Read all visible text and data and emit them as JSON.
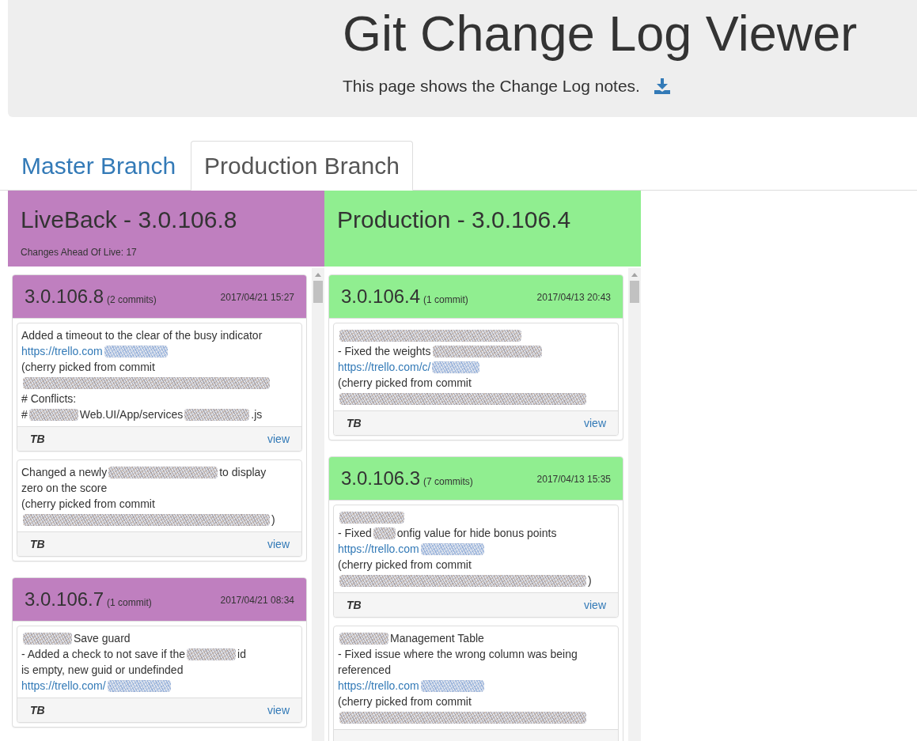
{
  "header": {
    "title": "Git Change Log Viewer",
    "subtitle": "This page shows the Change Log notes."
  },
  "tabs": [
    {
      "label": "Master Branch",
      "selected": false
    },
    {
      "label": "Production Branch",
      "selected": true
    }
  ],
  "columns": [
    {
      "title": "LiveBack - 3.0.106.8",
      "note": "Changes Ahead Of Live: 17",
      "color": "#bf7fbf",
      "releases": [
        {
          "version": "3.0.106.8",
          "commits_label": "(2 commits)",
          "date": "2017/04/21 15:27",
          "commits": [
            {
              "lines": [
                [
                  {
                    "kind": "text",
                    "text": "Added a timeout to the clear of the busy indicator"
                  }
                ],
                [
                  {
                    "kind": "link",
                    "text": "https://trello.com"
                  },
                  {
                    "kind": "linkblur_medium"
                  }
                ],
                [
                  {
                    "kind": "text",
                    "text": "(cherry picked from commit"
                  }
                ],
                [
                  {
                    "kind": "blur_full"
                  }
                ],
                [
                  {
                    "kind": "text",
                    "text": "# Conflicts:"
                  }
                ],
                [
                  {
                    "kind": "text",
                    "text": "#"
                  },
                  {
                    "kind": "blur_short"
                  },
                  {
                    "kind": "text",
                    "text": "Web.UI/App/services"
                  },
                  {
                    "kind": "blur_medium"
                  },
                  {
                    "kind": "text",
                    "text": ".js"
                  }
                ]
              ],
              "author": "TB",
              "action": "view"
            },
            {
              "lines": [
                [
                  {
                    "kind": "text",
                    "text": "Changed a newly"
                  },
                  {
                    "kind": "blur_long"
                  },
                  {
                    "kind": "text",
                    "text": "to display"
                  }
                ],
                [
                  {
                    "kind": "text",
                    "text": "zero on the score"
                  }
                ],
                [
                  {
                    "kind": "text",
                    "text": "(cherry picked from commit"
                  }
                ],
                [
                  {
                    "kind": "blur_full"
                  },
                  {
                    "kind": "text",
                    "text": ")"
                  }
                ]
              ],
              "author": "TB",
              "action": "view"
            }
          ]
        },
        {
          "version": "3.0.106.7",
          "commits_label": "(1 commit)",
          "date": "2017/04/21 08:34",
          "commits": [
            {
              "lines": [
                [
                  {
                    "kind": "blur_short"
                  },
                  {
                    "kind": "text",
                    "text": "Save guard"
                  }
                ],
                [
                  {
                    "kind": "text",
                    "text": "- Added a check to not save if the"
                  },
                  {
                    "kind": "blur_short"
                  },
                  {
                    "kind": "text",
                    "text": "id"
                  }
                ],
                [
                  {
                    "kind": "text",
                    "text": "is empty, new guid or undefinded"
                  }
                ],
                [
                  {
                    "kind": "link",
                    "text": "https://trello.com/"
                  },
                  {
                    "kind": "linkblur_medium"
                  }
                ]
              ],
              "author": "TB",
              "action": "view"
            }
          ]
        }
      ]
    },
    {
      "title": "Production - 3.0.106.4",
      "color": "#90ee90",
      "releases": [
        {
          "version": "3.0.106.4",
          "commits_label": "(1 commit)",
          "date": "2017/04/13 20:43",
          "commits": [
            {
              "lines": [
                [
                  {
                    "kind": "blur_wide"
                  }
                ],
                [
                  {
                    "kind": "text",
                    "text": "- Fixed the weights"
                  },
                  {
                    "kind": "blur_long"
                  }
                ],
                [
                  {
                    "kind": "link",
                    "text": "https://trello.com/c/"
                  },
                  {
                    "kind": "linkblur_short"
                  }
                ],
                [
                  {
                    "kind": "text",
                    "text": "(cherry picked from commit"
                  }
                ],
                [
                  {
                    "kind": "blur_full"
                  }
                ]
              ],
              "author": "TB",
              "action": "view"
            }
          ]
        },
        {
          "version": "3.0.106.3",
          "commits_label": "(7 commits)",
          "date": "2017/04/13 15:35",
          "commits": [
            {
              "lines": [
                [
                  {
                    "kind": "blur_medium"
                  }
                ],
                [
                  {
                    "kind": "text",
                    "text": "- Fixed"
                  },
                  {
                    "kind": "blur_tiny"
                  },
                  {
                    "kind": "text",
                    "text": "onfig value for hide bonus points"
                  }
                ],
                [
                  {
                    "kind": "link",
                    "text": "https://trello.com"
                  },
                  {
                    "kind": "linkblur_medium"
                  }
                ],
                [
                  {
                    "kind": "text",
                    "text": "(cherry picked from commit"
                  }
                ],
                [
                  {
                    "kind": "blur_full"
                  },
                  {
                    "kind": "text",
                    "text": ")"
                  }
                ]
              ],
              "author": "TB",
              "action": "view"
            },
            {
              "lines": [
                [
                  {
                    "kind": "blur_short"
                  },
                  {
                    "kind": "text",
                    "text": "Management Table"
                  }
                ],
                [
                  {
                    "kind": "text",
                    "text": "- Fixed issue where the wrong column was being referenced"
                  }
                ],
                [
                  {
                    "kind": "link",
                    "text": "https://trello.com"
                  },
                  {
                    "kind": "linkblur_medium"
                  }
                ],
                [
                  {
                    "kind": "text",
                    "text": "(cherry picked from commit"
                  }
                ],
                [
                  {
                    "kind": "blur_full"
                  }
                ]
              ]
            }
          ]
        }
      ]
    }
  ]
}
